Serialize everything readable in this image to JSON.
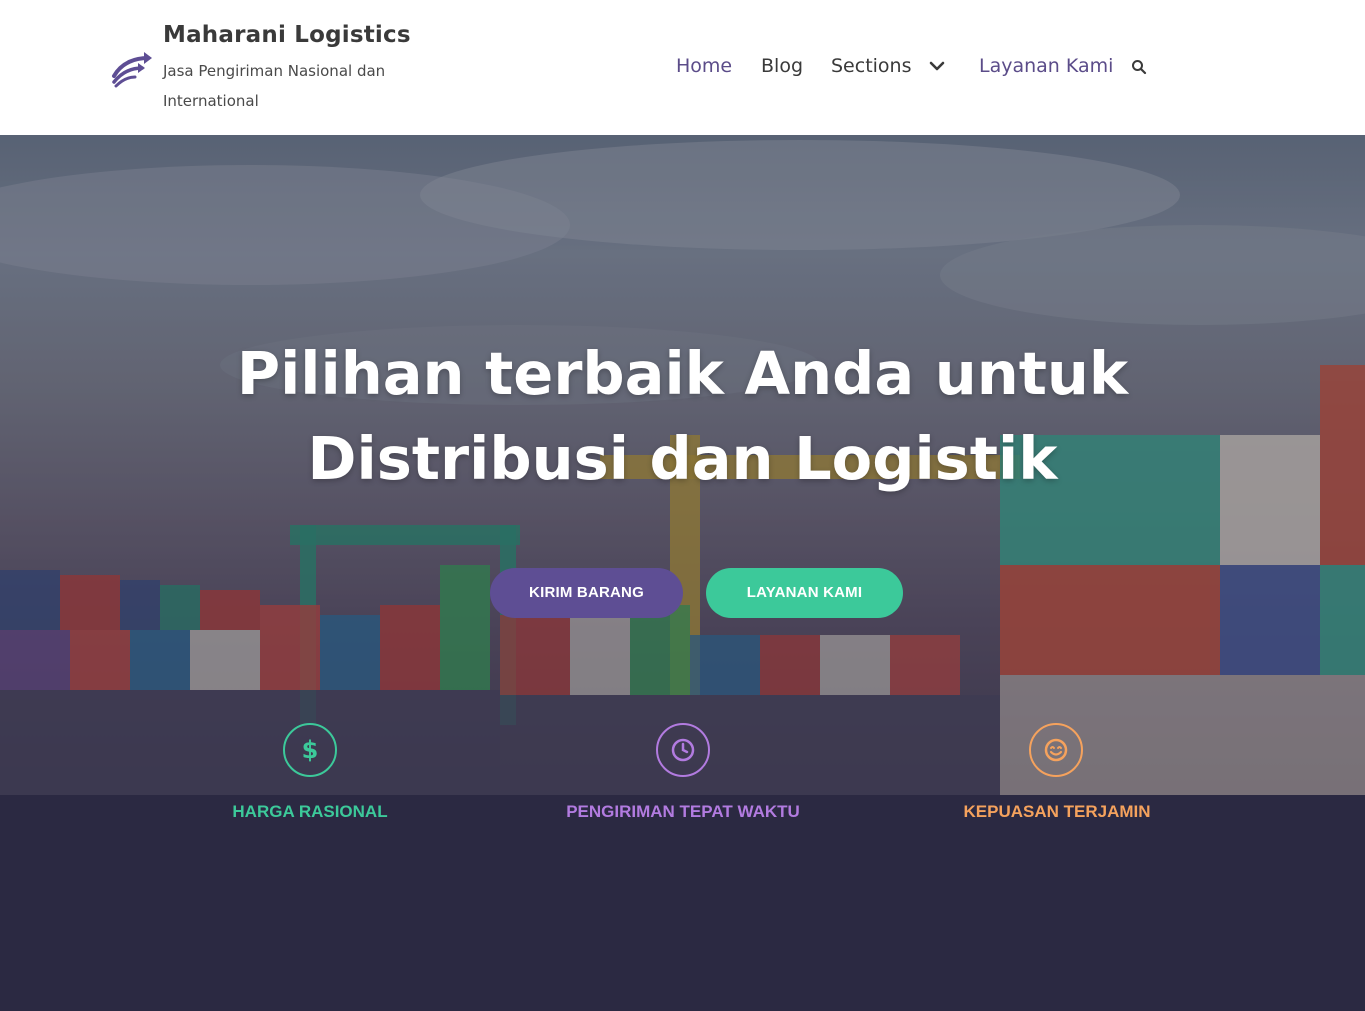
{
  "header": {
    "brand_title": "Maharani Logistics",
    "brand_tagline": "Jasa Pengiriman Nasional dan International",
    "logo_icon": "arrows-logo-icon"
  },
  "nav": {
    "items": [
      {
        "label": "Home"
      },
      {
        "label": "Blog"
      },
      {
        "label": "Sections"
      },
      {
        "label": "Layanan Kami"
      }
    ],
    "search_icon": "search-icon",
    "chevron_icon": "chevron-down-icon"
  },
  "hero": {
    "heading_line1": "Pilihan terbaik Anda untuk",
    "heading_line2": "Distribusi dan Logistik",
    "btn_primary": "KIRIM BARANG",
    "btn_secondary": "LAYANAN KAMI"
  },
  "features": [
    {
      "label": "HARGA RASIONAL",
      "icon": "dollar-icon",
      "color": "#3cc99a"
    },
    {
      "label": "PENGIRIMAN TEPAT WAKTU",
      "icon": "clock-icon",
      "color": "#b27be0"
    },
    {
      "label": "KEPUASAN TERJAMIN",
      "icon": "smile-icon",
      "color": "#f5a25d"
    }
  ],
  "colors": {
    "accent_purple": "#5e4e94",
    "accent_green": "#3cc99a",
    "footer_bg": "#2b2942"
  }
}
